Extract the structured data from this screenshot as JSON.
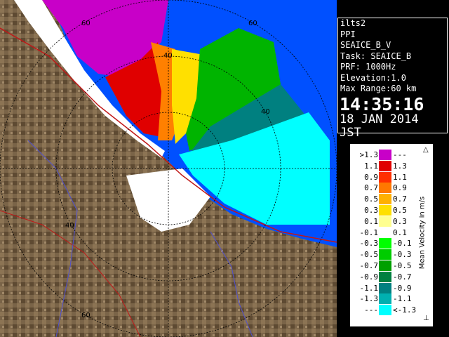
{
  "info": {
    "station": "ilts2",
    "mode": "PPI",
    "product": "SEAICE_B_V",
    "task": "Task: SEAICE_B",
    "prf": "PRF: 1000Hz",
    "elevation": "Elevation:1.0",
    "max_range": "Max Range:60 km",
    "time": "14:35:16",
    "date": "18 JAN 2014 JST"
  },
  "range_labels": [
    "60",
    "40",
    "40",
    "40",
    "60",
    "60"
  ],
  "legend": {
    "title": "Mean Velocity in m/s",
    "rows": [
      {
        "lo": ">1.3",
        "hi": "---",
        "color": "#c800c8"
      },
      {
        "lo": "1.1",
        "hi": "1.3",
        "color": "#e00000"
      },
      {
        "lo": "0.9",
        "hi": "1.1",
        "color": "#ff3000"
      },
      {
        "lo": "0.7",
        "hi": "0.9",
        "color": "#ff7800"
      },
      {
        "lo": "0.5",
        "hi": "0.7",
        "color": "#ffb000"
      },
      {
        "lo": "0.3",
        "hi": "0.5",
        "color": "#ffe000"
      },
      {
        "lo": "0.1",
        "hi": "0.3",
        "color": "#ffff90"
      },
      {
        "lo": "-0.1",
        "hi": "0.1",
        "color": "#ffffff"
      },
      {
        "lo": "-0.3",
        "hi": "-0.1",
        "color": "#00ff00"
      },
      {
        "lo": "-0.5",
        "hi": "-0.3",
        "color": "#00cc00"
      },
      {
        "lo": "-0.7",
        "hi": "-0.5",
        "color": "#00a000"
      },
      {
        "lo": "-0.9",
        "hi": "-0.7",
        "color": "#008040"
      },
      {
        "lo": "-1.1",
        "hi": "-0.9",
        "color": "#008080"
      },
      {
        "lo": "-1.3",
        "hi": "-1.1",
        "color": "#00b0b0"
      },
      {
        "lo": "---",
        "hi": "<-1.3",
        "color": "#00ffff"
      }
    ]
  },
  "colors": {
    "land": "#7a6448",
    "sea_no_echo": "#0050ff",
    "ring": "#000000",
    "roads": "#c01818",
    "rivers": "#5050d0"
  }
}
